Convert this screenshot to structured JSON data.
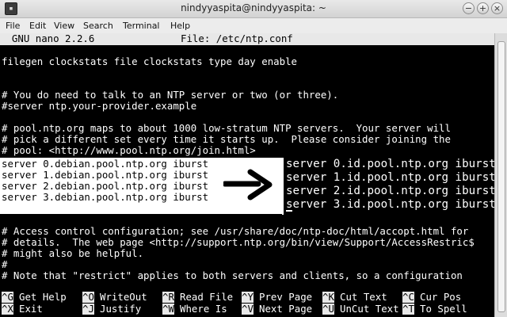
{
  "window": {
    "title": "nindyyaspita@nindyyaspita: ~",
    "buttons": {
      "minimize": "−",
      "maximize": "+",
      "close": "×"
    }
  },
  "menu": [
    "File",
    "Edit",
    "View",
    "Search",
    "Terminal",
    "Help"
  ],
  "nano": {
    "version": "  GNU nano 2.2.6",
    "file_label": "File: /etc/ntp.conf"
  },
  "lines": [
    "",
    "filegen clockstats file clockstats type day enable",
    "",
    "",
    "# You do need to talk to an NTP server or two (or three).",
    "#server ntp.your-provider.example",
    "",
    "# pool.ntp.org maps to about 1000 low-stratum NTP servers.  Your server will",
    "# pick a different set every time it starts up.  Please consider joining the",
    "# pool: <http://www.pool.ntp.org/join.html>"
  ],
  "lines_bottom": [
    "",
    "# Access control configuration; see /usr/share/doc/ntp-doc/html/accopt.html for",
    "# details.  The web page <http://support.ntp.org/bin/view/Support/AccessRestric$",
    "# might also be helpful.",
    "#",
    "# Note that \"restrict\" applies to both servers and clients, so a configuration"
  ],
  "servers_before": [
    "server 0.debian.pool.ntp.org iburst",
    "server 1.debian.pool.ntp.org iburst",
    "server 2.debian.pool.ntp.org iburst",
    "server 3.debian.pool.ntp.org iburst"
  ],
  "servers_after": [
    "server 0.id.pool.ntp.org iburst",
    "server 1.id.pool.ntp.org iburst",
    "server 2.id.pool.ntp.org iburst",
    "server 3.id.pool.ntp.org iburst"
  ],
  "shortcuts": [
    [
      {
        "key": "^G",
        "label": "Get Help"
      },
      {
        "key": "^O",
        "label": "WriteOut"
      },
      {
        "key": "^R",
        "label": "Read File"
      },
      {
        "key": "^Y",
        "label": "Prev Page"
      },
      {
        "key": "^K",
        "label": "Cut Text"
      },
      {
        "key": "^C",
        "label": "Cur Pos"
      }
    ],
    [
      {
        "key": "^X",
        "label": "Exit"
      },
      {
        "key": "^J",
        "label": "Justify"
      },
      {
        "key": "^W",
        "label": "Where Is"
      },
      {
        "key": "^V",
        "label": "Next Page"
      },
      {
        "key": "^U",
        "label": "UnCut Text"
      },
      {
        "key": "^T",
        "label": "To Spell"
      }
    ]
  ],
  "icons": {
    "arrow": "arrow-right-icon",
    "app": "terminal-icon"
  }
}
